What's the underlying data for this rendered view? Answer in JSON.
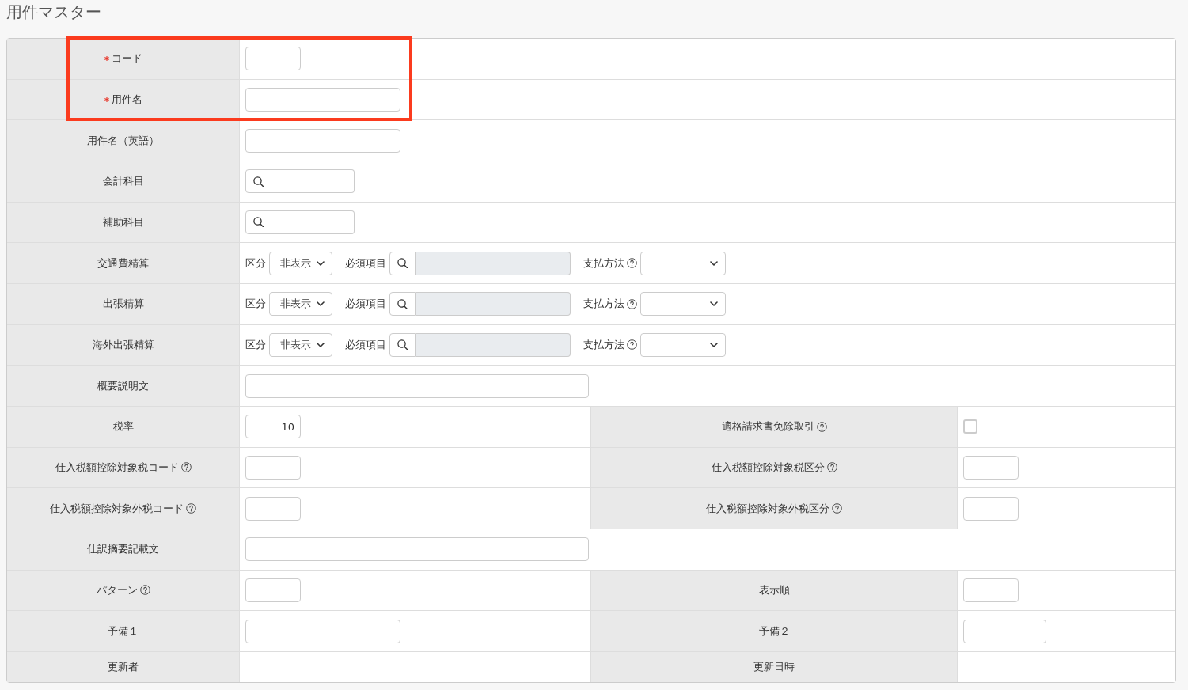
{
  "page": {
    "title": "用件マスター"
  },
  "form": {
    "rows": [
      {
        "highlighted": true,
        "groups": [
          {
            "label": "コード",
            "required": true,
            "help": false,
            "field": {
              "kind": "code"
            }
          }
        ]
      },
      {
        "highlighted": true,
        "groups": [
          {
            "label": "用件名",
            "required": true,
            "help": false,
            "field": {
              "kind": "text"
            }
          }
        ]
      },
      {
        "highlighted": false,
        "groups": [
          {
            "label": "用件名（英語）",
            "required": false,
            "help": false,
            "field": {
              "kind": "text"
            }
          }
        ]
      },
      {
        "highlighted": false,
        "groups": [
          {
            "label": "会計科目",
            "required": false,
            "help": false,
            "field": {
              "kind": "lookup",
              "disabled": false
            }
          }
        ]
      },
      {
        "highlighted": false,
        "groups": [
          {
            "label": "補助科目",
            "required": false,
            "help": false,
            "field": {
              "kind": "lookup",
              "disabled": false
            }
          }
        ]
      },
      {
        "highlighted": false,
        "groups": [
          {
            "label": "交通費精算",
            "required": false,
            "help": false,
            "field": {
              "kind": "settlement",
              "category": {
                "label": "区分",
                "value": "非表示"
              },
              "requirement": {
                "label": "必須項目",
                "disabled": true
              },
              "payment": {
                "label": "支払方法",
                "help": true
              }
            }
          }
        ]
      },
      {
        "highlighted": false,
        "groups": [
          {
            "label": "出張精算",
            "required": false,
            "help": false,
            "field": {
              "kind": "settlement",
              "category": {
                "label": "区分",
                "value": "非表示"
              },
              "requirement": {
                "label": "必須項目",
                "disabled": true
              },
              "payment": {
                "label": "支払方法",
                "help": true
              }
            }
          }
        ]
      },
      {
        "highlighted": false,
        "groups": [
          {
            "label": "海外出張精算",
            "required": false,
            "help": false,
            "field": {
              "kind": "settlement",
              "category": {
                "label": "区分",
                "value": "非表示"
              },
              "requirement": {
                "label": "必須項目",
                "disabled": true
              },
              "payment": {
                "label": "支払方法",
                "help": true
              }
            }
          }
        ]
      },
      {
        "highlighted": false,
        "groups": [
          {
            "label": "概要説明文",
            "required": false,
            "help": false,
            "field": {
              "kind": "memo"
            }
          }
        ]
      },
      {
        "highlighted": false,
        "groups": [
          {
            "label": "税率",
            "required": false,
            "help": false,
            "field": {
              "kind": "number",
              "value": "10"
            }
          },
          {
            "label": "適格請求書免除取引",
            "required": false,
            "help": true,
            "field": {
              "kind": "checkbox",
              "checked": false
            }
          }
        ]
      },
      {
        "highlighted": false,
        "groups": [
          {
            "label": "仕入税額控除対象税コード",
            "required": false,
            "help": true,
            "field": {
              "kind": "code"
            }
          },
          {
            "label": "仕入税額控除対象税区分",
            "required": false,
            "help": true,
            "field": {
              "kind": "code"
            }
          }
        ]
      },
      {
        "highlighted": false,
        "groups": [
          {
            "label": "仕入税額控除対象外税コード",
            "required": false,
            "help": true,
            "field": {
              "kind": "code"
            }
          },
          {
            "label": "仕入税額控除対象外税区分",
            "required": false,
            "help": true,
            "field": {
              "kind": "code"
            }
          }
        ]
      },
      {
        "highlighted": false,
        "groups": [
          {
            "label": "仕訳摘要記載文",
            "required": false,
            "help": false,
            "field": {
              "kind": "memo"
            }
          }
        ]
      },
      {
        "highlighted": false,
        "groups": [
          {
            "label": "パターン",
            "required": false,
            "help": true,
            "field": {
              "kind": "code"
            }
          },
          {
            "label": "表示順",
            "required": false,
            "help": false,
            "field": {
              "kind": "code"
            }
          }
        ]
      },
      {
        "highlighted": false,
        "groups": [
          {
            "label": "予備１",
            "required": false,
            "help": false,
            "field": {
              "kind": "text"
            }
          },
          {
            "label": "予備２",
            "required": false,
            "help": false,
            "field": {
              "kind": "short"
            }
          }
        ]
      },
      {
        "highlighted": false,
        "groups": [
          {
            "label": "更新者",
            "required": false,
            "help": false,
            "field": {
              "kind": "blank"
            }
          },
          {
            "label": "更新日時",
            "required": false,
            "help": false,
            "field": {
              "kind": "blank"
            }
          }
        ]
      }
    ]
  }
}
